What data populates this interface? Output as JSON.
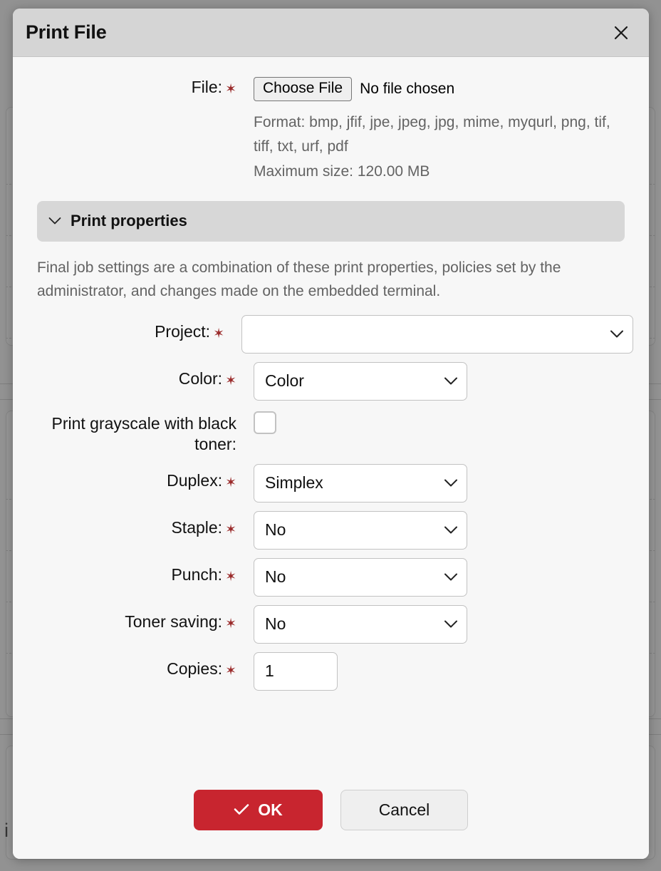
{
  "dialog": {
    "title": "Print File",
    "close_icon": "close-icon"
  },
  "file_section": {
    "label": "File:",
    "required_marker": "✶",
    "choose_button": "Choose File",
    "status": "No file chosen",
    "format_hint": "Format: bmp, jfif, jpe, jpeg, jpg, mime, myqurl, png, tif, tiff, txt, urf, pdf",
    "size_hint": "Maximum size: 120.00 MB"
  },
  "print_properties": {
    "header": "Print properties",
    "chevron_icon": "chevron-down-icon",
    "description": "Final job settings are a combination of these print properties, policies set by the administrator, and changes made on the embedded terminal.",
    "fields": [
      {
        "label": "Project:",
        "value": "",
        "type": "select",
        "required": true,
        "width": "w-project"
      },
      {
        "label": "Color:",
        "value": "Color",
        "type": "select",
        "required": true,
        "width": "w-std"
      },
      {
        "label": "Print grayscale with black toner:",
        "value": "",
        "type": "checkbox",
        "required": false,
        "checked": false
      },
      {
        "label": "Duplex:",
        "value": "Simplex",
        "type": "select",
        "required": true,
        "width": "w-std"
      },
      {
        "label": "Staple:",
        "value": "No",
        "type": "select",
        "required": true,
        "width": "w-std"
      },
      {
        "label": "Punch:",
        "value": "No",
        "type": "select",
        "required": true,
        "width": "w-std"
      },
      {
        "label": "Toner saving:",
        "value": "No",
        "type": "select",
        "required": true,
        "width": "w-std"
      },
      {
        "label": "Copies:",
        "value": "1",
        "type": "text",
        "required": true,
        "width": "w-copies"
      }
    ]
  },
  "footer": {
    "ok_label": "OK",
    "ok_icon": "check-icon",
    "cancel_label": "Cancel"
  },
  "backdrop": {
    "stray_letter": "i"
  },
  "colors": {
    "accent_red": "#c8252f",
    "required_red": "#9b2c2c",
    "header_gray": "#d5d5d5",
    "section_gray": "#d7d7d7",
    "page_bg": "#f7f7f7"
  }
}
